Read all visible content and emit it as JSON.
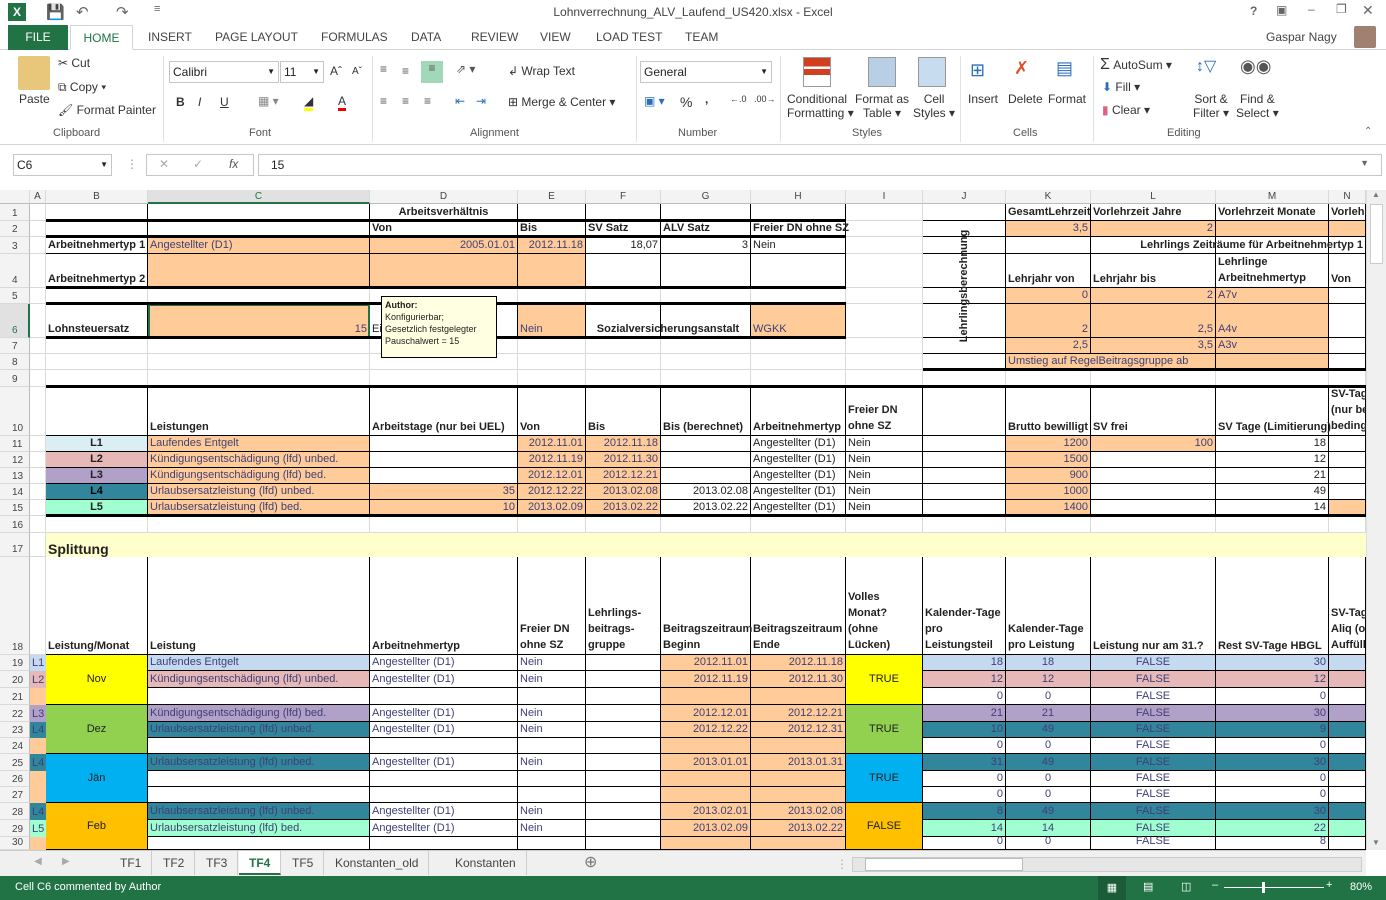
{
  "app": {
    "title": "Lohnverrechnung_ALV_Laufend_US420.xlsx - Excel",
    "user": "Gaspar Nagy",
    "help": "?"
  },
  "tabs": [
    "FILE",
    "HOME",
    "INSERT",
    "PAGE LAYOUT",
    "FORMULAS",
    "DATA",
    "REVIEW",
    "VIEW",
    "LOAD TEST",
    "TEAM"
  ],
  "ribbon": {
    "clipboard": {
      "paste": "Paste",
      "cut": "Cut",
      "copy": "Copy",
      "format_painter": "Format Painter",
      "label": "Clipboard"
    },
    "font": {
      "name": "Calibri",
      "size": "11",
      "bold": "B",
      "italic": "I",
      "underline": "U",
      "label": "Font"
    },
    "alignment": {
      "wrap": "Wrap Text",
      "merge": "Merge & Center",
      "label": "Alignment"
    },
    "number": {
      "format": "General",
      "percent": "%",
      "comma": ",",
      "label": "Number"
    },
    "styles": {
      "cond": "Conditional",
      "cond2": "Formatting",
      "fat": "Format as",
      "fat2": "Table",
      "cell": "Cell",
      "cell2": "Styles",
      "label": "Styles"
    },
    "cells": {
      "insert": "Insert",
      "delete": "Delete",
      "format": "Format",
      "label": "Cells"
    },
    "editing": {
      "autosum": "AutoSum",
      "fill": "Fill",
      "clear": "Clear",
      "sort": "Sort &",
      "sort2": "Filter",
      "find": "Find &",
      "find2": "Select",
      "label": "Editing"
    }
  },
  "formula_bar": {
    "name_box": "C6",
    "fx": "fx",
    "value": "15"
  },
  "columns": [
    "A",
    "B",
    "C",
    "D",
    "E",
    "F",
    "G",
    "H",
    "I",
    "J",
    "K",
    "L",
    "M",
    "N"
  ],
  "selected_column": "C",
  "selected_row": 6,
  "comment": {
    "author": "Author:",
    "lines": [
      "Konfigurierbar;",
      "Gesetzlich festgelegter",
      "Pauschalwert = 15"
    ]
  },
  "colors": {
    "input_fill": "#FFCC99",
    "input_font": "#3F3F76",
    "accent": "#217346"
  },
  "cells": [
    {
      "a": "D1",
      "t": "Arbeitsverhältnis",
      "s": "b c"
    },
    {
      "a": "D2",
      "t": "Von",
      "s": "b"
    },
    {
      "a": "E2",
      "t": "Bis",
      "s": "b"
    },
    {
      "a": "F2",
      "t": "SV Satz",
      "s": "b"
    },
    {
      "a": "G2",
      "t": "ALV Satz",
      "s": "b"
    },
    {
      "a": "H2",
      "t": "Freier DN ohne SZ",
      "s": "b"
    },
    {
      "a": "B3",
      "t": "Arbeitnehmertyp 1",
      "s": "b"
    },
    {
      "a": "C3",
      "t": "Angestellter (D1)",
      "s": "i",
      "f": "#FFCC99"
    },
    {
      "a": "D3",
      "t": "2005.01.01",
      "s": "i r",
      "f": "#FFCC99"
    },
    {
      "a": "E3",
      "t": "2012.11.18",
      "s": "i r",
      "f": "#FFCC99"
    },
    {
      "a": "F3",
      "t": "18,07",
      "s": "r"
    },
    {
      "a": "G3",
      "t": "3",
      "s": "r"
    },
    {
      "a": "H3",
      "t": "Nein",
      "s": ""
    },
    {
      "a": "B4",
      "t": "Arbeitnehmertyp 2",
      "s": "b"
    },
    {
      "a": "C4",
      "t": "",
      "s": "i",
      "f": "#FFCC99"
    },
    {
      "a": "D4",
      "t": "",
      "s": "i",
      "f": "#FFCC99"
    },
    {
      "a": "E4",
      "t": "",
      "s": "i",
      "f": "#FFCC99"
    },
    {
      "a": "B6",
      "t": "Lohnsteuersatz",
      "s": "b"
    },
    {
      "a": "C6",
      "t": "15",
      "s": "i r",
      "f": "#FFCC99"
    },
    {
      "a": "D6",
      "t": "Ei m",
      "s": ""
    },
    {
      "a": "E6",
      "t": "Nein",
      "s": "i",
      "f": "#FFCC99"
    },
    {
      "a": "F6:G6",
      "t": "Sozialversicherungsanstalt",
      "s": "b c"
    },
    {
      "a": "H6",
      "t": "WGKK",
      "s": "i",
      "f": "#FFCC99"
    },
    {
      "a": "J1:J8",
      "t": "Lehrlingsberechnung",
      "s": "b c m rot"
    },
    {
      "a": "K1",
      "t": "GesamtLehrzeit",
      "s": "b"
    },
    {
      "a": "L1",
      "t": "Vorlehrzeit Jahre",
      "s": "b"
    },
    {
      "a": "M1",
      "t": "Vorlehrzeit Monate",
      "s": "b"
    },
    {
      "a": "N1",
      "t": "Vorlehrzeit",
      "s": "b"
    },
    {
      "a": "K2",
      "t": "3,5",
      "s": "i r",
      "f": "#FFCC99"
    },
    {
      "a": "L2",
      "t": "2",
      "s": "i r",
      "f": "#FFCC99"
    },
    {
      "a": "M2",
      "t": "",
      "s": "i",
      "f": "#FFCC99"
    },
    {
      "a": "N2",
      "t": "",
      "s": "i",
      "f": "#FFCC99"
    },
    {
      "a": "K3:N3",
      "t": "Lehrlings Zeiträume für Arbeitnehmertyp 1",
      "s": "b r"
    },
    {
      "a": "K4",
      "t": "Lehrjahr von",
      "s": "b"
    },
    {
      "a": "L4",
      "t": "Lehrjahr bis",
      "s": "b"
    },
    {
      "a": "M4",
      "t": "Lehrlinge Arbeitnehmertyp",
      "s": "b w"
    },
    {
      "a": "N4",
      "t": "Von",
      "s": "b"
    },
    {
      "a": "K5",
      "t": "0",
      "s": "i r",
      "f": "#FFCC99"
    },
    {
      "a": "L5",
      "t": "2",
      "s": "i r",
      "f": "#FFCC99"
    },
    {
      "a": "M5",
      "t": "A7v",
      "s": "i",
      "f": "#FFCC99"
    },
    {
      "a": "K6",
      "t": "2",
      "s": "i r",
      "f": "#FFCC99"
    },
    {
      "a": "L6",
      "t": "2,5",
      "s": "i r",
      "f": "#FFCC99"
    },
    {
      "a": "M6",
      "t": "A4v",
      "s": "i",
      "f": "#FFCC99"
    },
    {
      "a": "K7",
      "t": "2,5",
      "s": "i r",
      "f": "#FFCC99"
    },
    {
      "a": "L7",
      "t": "3,5",
      "s": "i r",
      "f": "#FFCC99"
    },
    {
      "a": "M7",
      "t": "A3v",
      "s": "i",
      "f": "#FFCC99"
    },
    {
      "a": "K8:L8",
      "t": "Umstieg auf RegelBeitragsgruppe ab",
      "s": "i",
      "f": "#FFCC99"
    },
    {
      "a": "M8",
      "t": "",
      "s": "i",
      "f": "#FFCC99"
    },
    {
      "a": "C10",
      "t": "Leistungen",
      "s": "b"
    },
    {
      "a": "D10",
      "t": "Arbeitstage (nur bei UEL)",
      "s": "b"
    },
    {
      "a": "E10",
      "t": "Von",
      "s": "b"
    },
    {
      "a": "F10",
      "t": "Bis",
      "s": "b"
    },
    {
      "a": "G10",
      "t": "Bis (berechnet)",
      "s": "b"
    },
    {
      "a": "H10",
      "t": "Arbeitnehmertyp",
      "s": "b"
    },
    {
      "a": "I10",
      "t": "Freier DN ohne SZ",
      "s": "b w"
    },
    {
      "a": "K10",
      "t": "Brutto bewilligt",
      "s": "b"
    },
    {
      "a": "L10",
      "t": "SV frei",
      "s": "b"
    },
    {
      "a": "M10",
      "t": "SV Tage (Limitierung)",
      "s": "b"
    },
    {
      "a": "N10",
      "t": "SV-Tage (nur bei bedingt)",
      "s": "b w"
    },
    {
      "a": "B11",
      "t": "L1",
      "s": "b c",
      "f": "#DAEEF3"
    },
    {
      "a": "C11",
      "t": "Laufendes Entgelt",
      "s": "i",
      "f": "#FFCC99"
    },
    {
      "a": "E11",
      "t": "2012.11.01",
      "s": "i r",
      "f": "#FFCC99"
    },
    {
      "a": "F11",
      "t": "2012.11.18",
      "s": "i r",
      "f": "#FFCC99"
    },
    {
      "a": "H11",
      "t": "Angestellter (D1)",
      "s": ""
    },
    {
      "a": "I11",
      "t": "Nein",
      "s": ""
    },
    {
      "a": "K11",
      "t": "1200",
      "s": "i r",
      "f": "#FFCC99"
    },
    {
      "a": "L11",
      "t": "100",
      "s": "i r",
      "f": "#FFCC99"
    },
    {
      "a": "M11",
      "t": "18",
      "s": "r"
    },
    {
      "a": "B12",
      "t": "L2",
      "s": "b c",
      "f": "#E6B8B7"
    },
    {
      "a": "C12",
      "t": "Kündigungsentschädigung (lfd) unbed.",
      "s": "i",
      "f": "#FFCC99"
    },
    {
      "a": "E12",
      "t": "2012.11.19",
      "s": "i r",
      "f": "#FFCC99"
    },
    {
      "a": "F12",
      "t": "2012.11.30",
      "s": "i r",
      "f": "#FFCC99"
    },
    {
      "a": "H12",
      "t": "Angestellter (D1)",
      "s": ""
    },
    {
      "a": "I12",
      "t": "Nein",
      "s": ""
    },
    {
      "a": "K12",
      "t": "1500",
      "s": "i r",
      "f": "#FFCC99"
    },
    {
      "a": "M12",
      "t": "12",
      "s": "r"
    },
    {
      "a": "B13",
      "t": "L3",
      "s": "b c",
      "f": "#B1A0C7"
    },
    {
      "a": "C13",
      "t": "Kündigungsentschädigung (lfd) bed.",
      "s": "i",
      "f": "#FFCC99"
    },
    {
      "a": "E13",
      "t": "2012.12.01",
      "s": "i r",
      "f": "#FFCC99"
    },
    {
      "a": "F13",
      "t": "2012.12.21",
      "s": "i r",
      "f": "#FFCC99"
    },
    {
      "a": "H13",
      "t": "Angestellter (D1)",
      "s": ""
    },
    {
      "a": "I13",
      "t": "Nein",
      "s": ""
    },
    {
      "a": "K13",
      "t": "900",
      "s": "i r",
      "f": "#FFCC99"
    },
    {
      "a": "M13",
      "t": "21",
      "s": "r"
    },
    {
      "a": "B14",
      "t": "L4",
      "s": "b c",
      "f": "#31869B"
    },
    {
      "a": "C14",
      "t": "Urlaubsersatzleistung (lfd) unbed.",
      "s": "i",
      "f": "#FFCC99"
    },
    {
      "a": "D14",
      "t": "35",
      "s": "i r",
      "f": "#FFCC99"
    },
    {
      "a": "E14",
      "t": "2012.12.22",
      "s": "i r",
      "f": "#FFCC99"
    },
    {
      "a": "F14",
      "t": "2013.02.08",
      "s": "i r",
      "f": "#FFCC99"
    },
    {
      "a": "G14",
      "t": "2013.02.08",
      "s": "r"
    },
    {
      "a": "H14",
      "t": "Angestellter (D1)",
      "s": ""
    },
    {
      "a": "I14",
      "t": "Nein",
      "s": ""
    },
    {
      "a": "K14",
      "t": "1000",
      "s": "i r",
      "f": "#FFCC99"
    },
    {
      "a": "M14",
      "t": "49",
      "s": "r"
    },
    {
      "a": "B15",
      "t": "L5",
      "s": "b c",
      "f": "#A0FFD0"
    },
    {
      "a": "C15",
      "t": "Urlaubsersatzleistung (lfd) bed.",
      "s": "i",
      "f": "#FFCC99"
    },
    {
      "a": "D15",
      "t": "10",
      "s": "i r",
      "f": "#FFCC99"
    },
    {
      "a": "E15",
      "t": "2013.02.09",
      "s": "i r",
      "f": "#FFCC99"
    },
    {
      "a": "F15",
      "t": "2013.02.22",
      "s": "i r",
      "f": "#FFCC99"
    },
    {
      "a": "G15",
      "t": "2013.02.22",
      "s": "r"
    },
    {
      "a": "H15",
      "t": "Angestellter (D1)",
      "s": ""
    },
    {
      "a": "I15",
      "t": "Nein",
      "s": ""
    },
    {
      "a": "K15",
      "t": "1400",
      "s": "i r",
      "f": "#FFCC99"
    },
    {
      "a": "M15",
      "t": "14",
      "s": "r"
    },
    {
      "a": "N15",
      "t": "",
      "s": "",
      "f": "#FFCC99"
    },
    {
      "a": "B17:N17",
      "t": "Splittung",
      "s": "b big",
      "f": "#FFFFCC"
    },
    {
      "a": "B18",
      "t": "Leistung/Monat",
      "s": "b"
    },
    {
      "a": "C18",
      "t": "Leistung",
      "s": "b"
    },
    {
      "a": "D18",
      "t": "Arbeitnehmertyp",
      "s": "b"
    },
    {
      "a": "E18",
      "t": "Freier DN ohne SZ",
      "s": "b w"
    },
    {
      "a": "F18",
      "t": "Lehrlings-beitrags-gruppe",
      "s": "b w"
    },
    {
      "a": "G18",
      "t": "Beitragszeitraum Beginn",
      "s": "b w"
    },
    {
      "a": "H18",
      "t": "Beitragszeitraum Ende",
      "s": "b w"
    },
    {
      "a": "I18",
      "t": "Volles Monat? (ohne Lücken)",
      "s": "b w"
    },
    {
      "a": "J18",
      "t": "Kalender-Tage pro Leistungsteil",
      "s": "b w"
    },
    {
      "a": "K18",
      "t": "Kalender-Tage pro Leistung",
      "s": "b w"
    },
    {
      "a": "L18",
      "t": "Leistung nur am 31.?",
      "s": "b"
    },
    {
      "a": "M18",
      "t": "Rest SV-Tage HBGL",
      "s": "b"
    },
    {
      "a": "N18",
      "t": "SV-Tage Aliq (ohne Auffüllung)",
      "s": "b w"
    },
    {
      "a": "B19:B21",
      "t": "Nov",
      "s": "c m",
      "f": "#FFFF00"
    },
    {
      "a": "I19:I21",
      "t": "TRUE",
      "s": "c m",
      "f": "#FFFF00"
    },
    {
      "a": "B22:B24",
      "t": "Dez",
      "s": "c m",
      "f": "#92D050"
    },
    {
      "a": "I22:I24",
      "t": "TRUE",
      "s": "c m",
      "f": "#92D050"
    },
    {
      "a": "B25:B27",
      "t": "Jän",
      "s": "c m",
      "f": "#00B0F0"
    },
    {
      "a": "I25:I27",
      "t": "TRUE",
      "s": "c m",
      "f": "#00B0F0"
    },
    {
      "a": "B28:B30",
      "t": "Feb",
      "s": "c m",
      "f": "#FFC000"
    },
    {
      "a": "I28:I30",
      "t": "FALSE",
      "s": "c m",
      "f": "#FFC000"
    }
  ],
  "split_rows": [
    {
      "r": 19,
      "id": "L1",
      "fill": "#C5D9F1",
      "leistung": "Laufendes Entgelt",
      "typ": "Angestellter (D1)",
      "freier": "Nein",
      "beginn": "2012.11.01",
      "ende": "2012.11.18",
      "kt_teil": "18",
      "kt_leistung": "18",
      "nur31": "FALSE",
      "rest": "30"
    },
    {
      "r": 20,
      "id": "L2",
      "fill": "#E6B8B7",
      "leistung": "Kündigungsentschädigung (lfd) unbed.",
      "typ": "Angestellter (D1)",
      "freier": "Nein",
      "beginn": "2012.11.19",
      "ende": "2012.11.30",
      "kt_teil": "12",
      "kt_leistung": "12",
      "nur31": "FALSE",
      "rest": "12"
    },
    {
      "r": 21,
      "id": "",
      "fill": "",
      "leistung": "",
      "typ": "",
      "freier": "",
      "beginn": "",
      "ende": "",
      "kt_teil": "0",
      "kt_leistung": "0",
      "nur31": "FALSE",
      "rest": "0"
    },
    {
      "r": 22,
      "id": "L3",
      "fill": "#B1A0C7",
      "leistung": "Kündigungsentschädigung (lfd) bed.",
      "typ": "Angestellter (D1)",
      "freier": "Nein",
      "beginn": "2012.12.01",
      "ende": "2012.12.21",
      "kt_teil": "21",
      "kt_leistung": "21",
      "nur31": "FALSE",
      "rest": "30"
    },
    {
      "r": 23,
      "id": "L4",
      "fill": "#31869B",
      "leistung": "Urlaubsersatzleistung (lfd) unbed.",
      "typ": "Angestellter (D1)",
      "freier": "Nein",
      "beginn": "2012.12.22",
      "ende": "2012.12.31",
      "kt_teil": "10",
      "kt_leistung": "49",
      "nur31": "FALSE",
      "rest": "9"
    },
    {
      "r": 24,
      "id": "",
      "fill": "",
      "leistung": "",
      "typ": "",
      "freier": "",
      "beginn": "",
      "ende": "",
      "kt_teil": "0",
      "kt_leistung": "0",
      "nur31": "FALSE",
      "rest": "0"
    },
    {
      "r": 25,
      "id": "L4",
      "fill": "#31869B",
      "leistung": "Urlaubsersatzleistung (lfd) unbed.",
      "typ": "Angestellter (D1)",
      "freier": "Nein",
      "beginn": "2013.01.01",
      "ende": "2013.01.31",
      "kt_teil": "31",
      "kt_leistung": "49",
      "nur31": "FALSE",
      "rest": "30"
    },
    {
      "r": 26,
      "id": "",
      "fill": "",
      "leistung": "",
      "typ": "",
      "freier": "",
      "beginn": "",
      "ende": "",
      "kt_teil": "0",
      "kt_leistung": "0",
      "nur31": "FALSE",
      "rest": "0"
    },
    {
      "r": 27,
      "id": "",
      "fill": "",
      "leistung": "",
      "typ": "",
      "freier": "",
      "beginn": "",
      "ende": "",
      "kt_teil": "0",
      "kt_leistung": "0",
      "nur31": "FALSE",
      "rest": "0"
    },
    {
      "r": 28,
      "id": "L4",
      "fill": "#31869B",
      "leistung": "Urlaubsersatzleistung (lfd) unbed.",
      "typ": "Angestellter (D1)",
      "freier": "Nein",
      "beginn": "2013.02.01",
      "ende": "2013.02.08",
      "kt_teil": "8",
      "kt_leistung": "49",
      "nur31": "FALSE",
      "rest": "30"
    },
    {
      "r": 29,
      "id": "L5",
      "fill": "#A0FFD0",
      "leistung": "Urlaubsersatzleistung (lfd) bed.",
      "typ": "Angestellter (D1)",
      "freier": "Nein",
      "beginn": "2013.02.09",
      "ende": "2013.02.22",
      "kt_teil": "14",
      "kt_leistung": "14",
      "nur31": "FALSE",
      "rest": "22"
    },
    {
      "r": 30,
      "id": "",
      "fill": "",
      "leistung": "",
      "typ": "",
      "freier": "",
      "beginn": "",
      "ende": "",
      "kt_teil": "0",
      "kt_leistung": "0",
      "nur31": "FALSE",
      "rest": "8"
    }
  ],
  "sheet_tabs": [
    "TF1",
    "TF2",
    "TF3",
    "TF4",
    "TF5",
    "Konstanten_old",
    "Konstanten"
  ],
  "active_sheet": "TF4",
  "status": {
    "text": "Cell C6 commented by Author",
    "zoom": "80%"
  }
}
